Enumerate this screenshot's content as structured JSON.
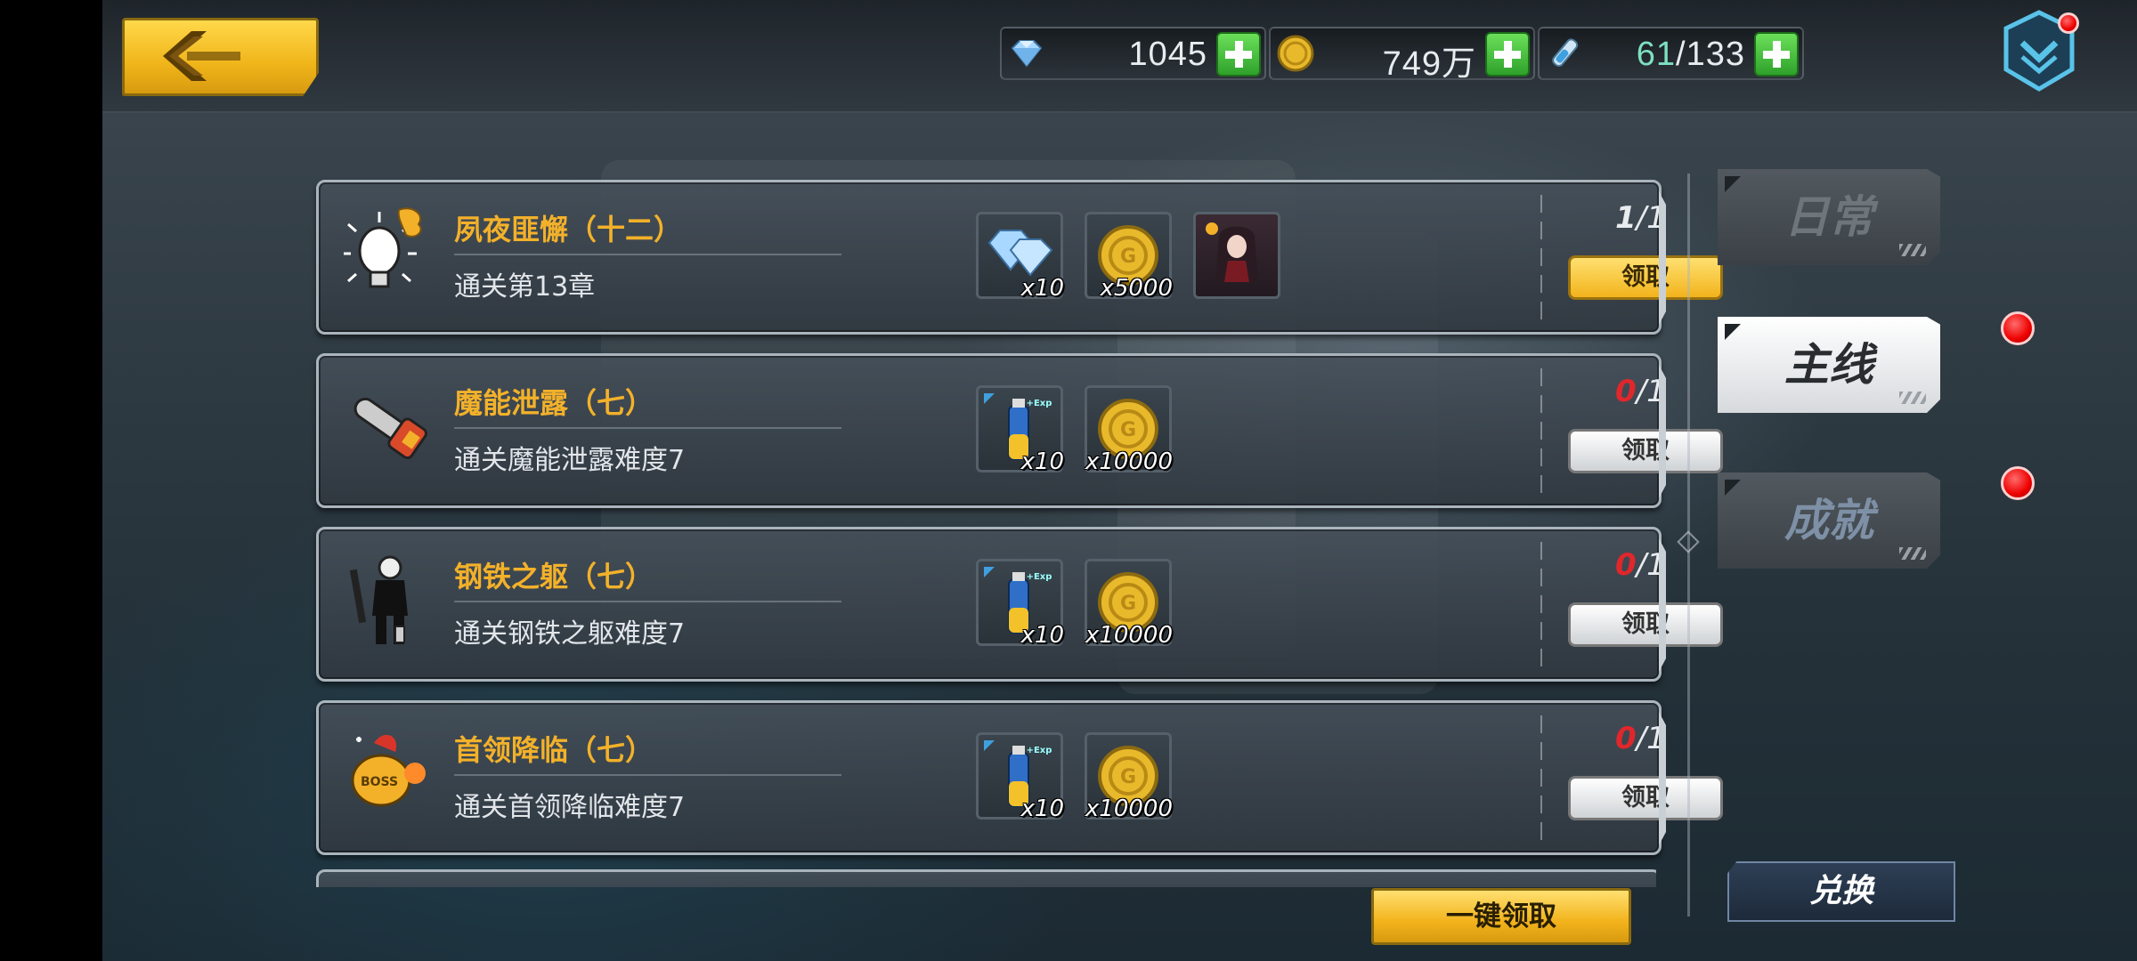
{
  "currency": {
    "diamonds": "1045",
    "gold": "749万",
    "stamina_current": "61",
    "stamina_separator": "/",
    "stamina_max": "133"
  },
  "quests": [
    {
      "title": "夙夜匪懈（十二）",
      "description": "通关第13章",
      "icon": "lightbulb-icon",
      "rewards": [
        {
          "type": "diamond",
          "count": "x10"
        },
        {
          "type": "gold-coin",
          "count": "x5000"
        },
        {
          "type": "character-portrait",
          "count": ""
        }
      ],
      "progress_current": "1",
      "progress_total": "/1",
      "claim_label": "领取",
      "claimable": true
    },
    {
      "title": "魔能泄露（七）",
      "description": "通关魔能泄露难度7",
      "icon": "chainsaw-icon",
      "rewards": [
        {
          "type": "exp-potion",
          "count": "x10"
        },
        {
          "type": "gold-coin",
          "count": "x10000"
        }
      ],
      "progress_current": "0",
      "progress_total": "/1",
      "claim_label": "领取",
      "claimable": false
    },
    {
      "title": "钢铁之躯（七）",
      "description": "通关钢铁之躯难度7",
      "icon": "soldier-icon",
      "rewards": [
        {
          "type": "exp-potion",
          "count": "x10"
        },
        {
          "type": "gold-coin",
          "count": "x10000"
        }
      ],
      "progress_current": "0",
      "progress_total": "/1",
      "claim_label": "领取",
      "claimable": false
    },
    {
      "title": "首领降临（七）",
      "description": "通关首领降临难度7",
      "icon": "boss-icon",
      "rewards": [
        {
          "type": "exp-potion",
          "count": "x10"
        },
        {
          "type": "gold-coin",
          "count": "x10000"
        }
      ],
      "progress_current": "0",
      "progress_total": "/1",
      "claim_label": "领取",
      "claimable": false
    }
  ],
  "tabs": {
    "daily": "日常",
    "main": "主线",
    "achievement": "成就"
  },
  "exchange_label": "兑换",
  "claim_all_label": "一键领取",
  "exp_badge": "+Exp",
  "boss_badge": "BOSS",
  "colors": {
    "accent_gold": "#f3b12a",
    "progress_red": "#e0272c",
    "plus_green": "#2fa12b"
  }
}
